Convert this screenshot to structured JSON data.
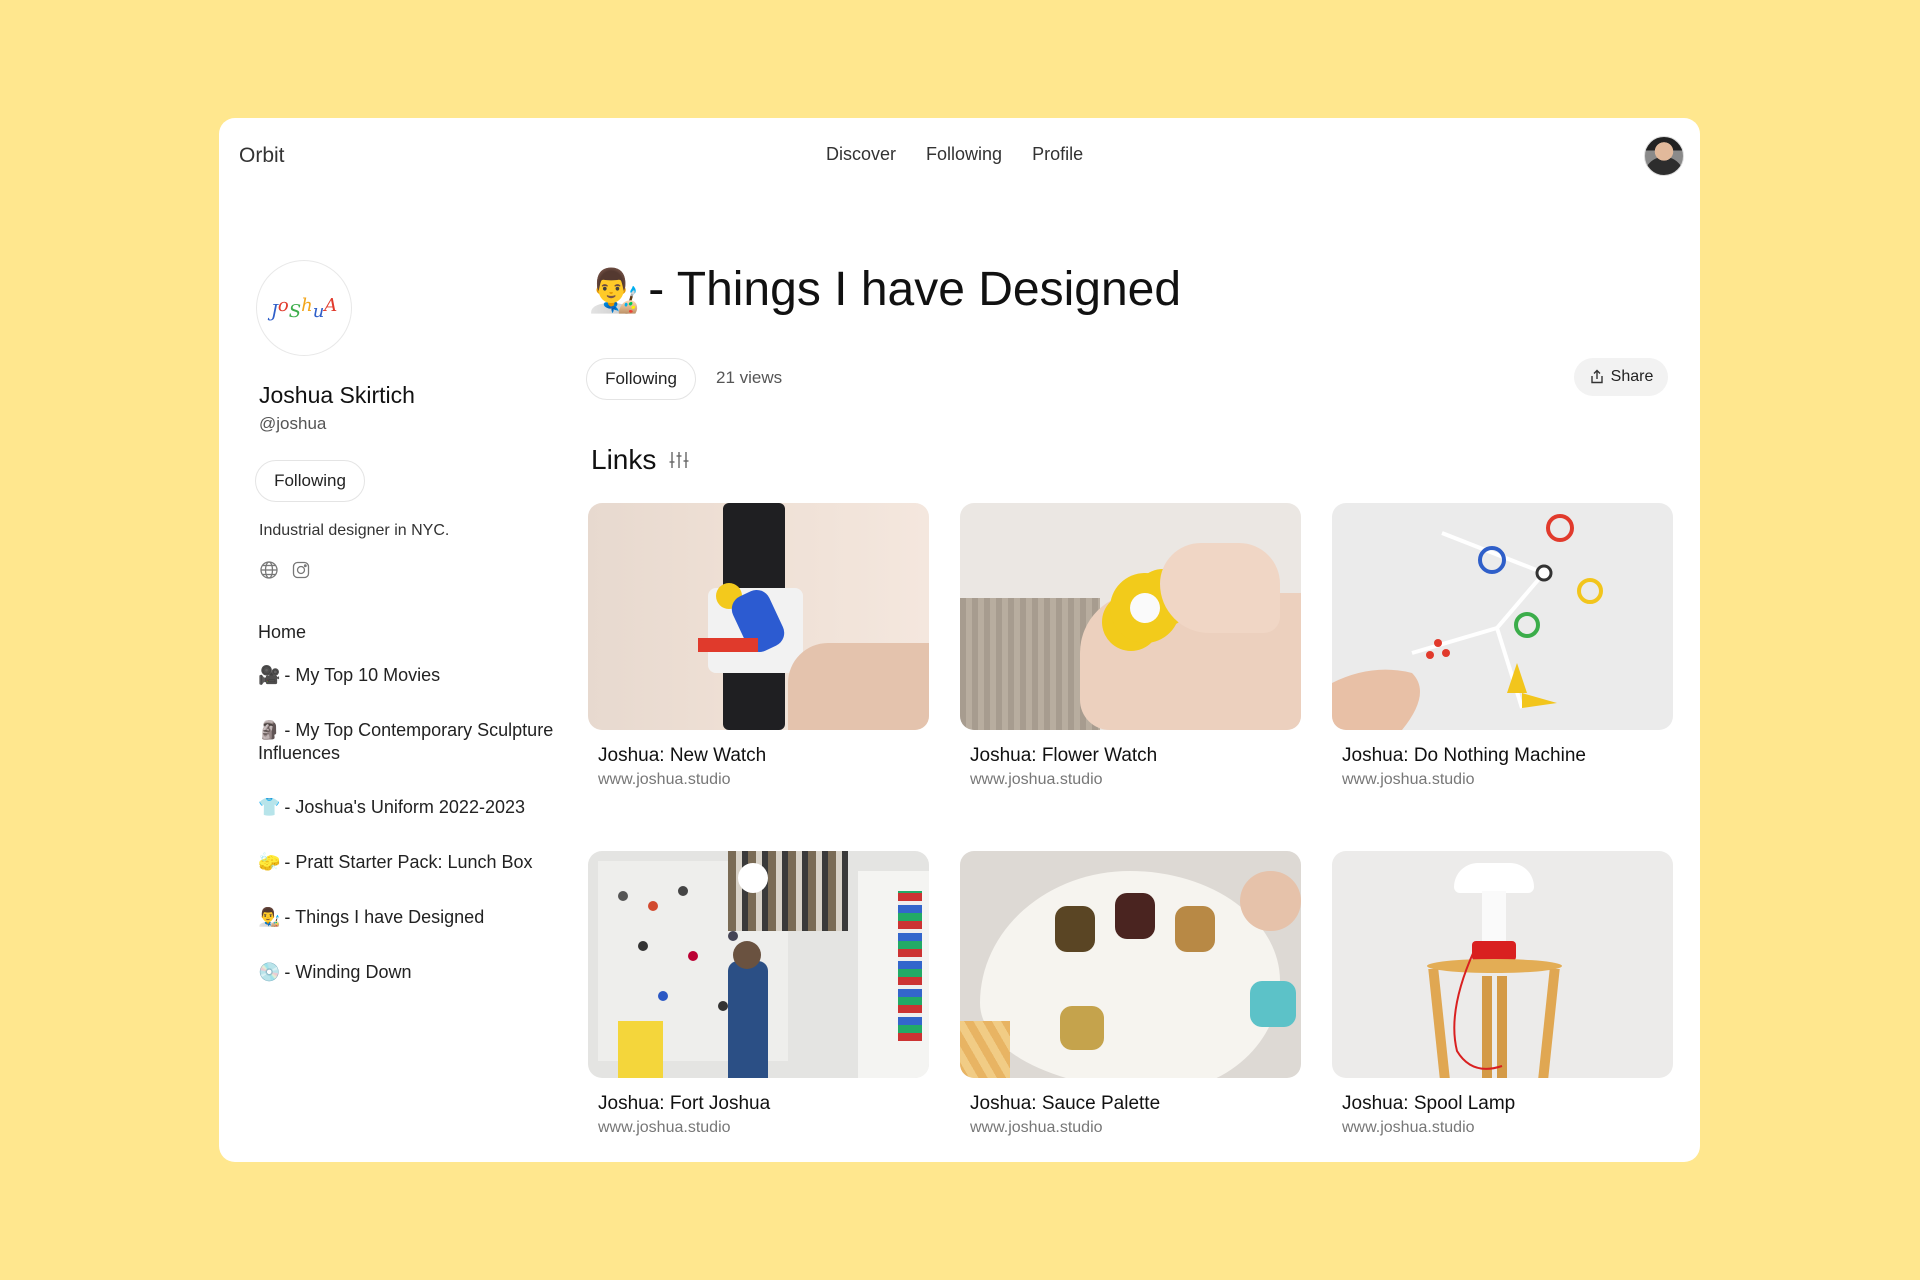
{
  "app": {
    "brand": "Orbit"
  },
  "topnav": {
    "items": [
      "Discover",
      "Following",
      "Profile"
    ]
  },
  "profile": {
    "logo_text": "JoShuA",
    "name": "Joshua Skirtich",
    "handle": "@joshua",
    "follow_label": "Following",
    "bio": "Industrial designer in NYC.",
    "social_icons": [
      "globe-icon",
      "instagram-icon"
    ]
  },
  "sidebar": {
    "home_label": "Home",
    "items": [
      {
        "emoji": "🎥",
        "label": "- My Top 10 Movies"
      },
      {
        "emoji": "🗿",
        "label": "- My Top Contemporary Sculpture Influences"
      },
      {
        "emoji": "👕",
        "label": "- Joshua's Uniform 2022-2023"
      },
      {
        "emoji": "🧽",
        "label": "- Pratt Starter Pack: Lunch Box"
      },
      {
        "emoji": "👨‍🎨",
        "label": "- Things I have Designed",
        "active": true
      },
      {
        "emoji": "💿",
        "label": "- Winding Down"
      }
    ]
  },
  "page": {
    "emoji": "👨‍🎨",
    "title": "- Things I have Designed",
    "follow_label": "Following",
    "views": "21 views",
    "share_label": "Share",
    "section_title": "Links"
  },
  "links": [
    {
      "title": "Joshua: New Watch",
      "url": "www.joshua.studio"
    },
    {
      "title": "Joshua: Flower Watch",
      "url": "www.joshua.studio"
    },
    {
      "title": "Joshua: Do Nothing Machine",
      "url": "www.joshua.studio"
    },
    {
      "title": "Joshua: Fort Joshua",
      "url": "www.joshua.studio"
    },
    {
      "title": "Joshua: Sauce Palette",
      "url": "www.joshua.studio"
    },
    {
      "title": "Joshua: Spool Lamp",
      "url": "www.joshua.studio"
    }
  ],
  "colors": {
    "background": "#FFE78E",
    "panel": "#FFFFFF",
    "active_item": "#F3F3F3"
  }
}
